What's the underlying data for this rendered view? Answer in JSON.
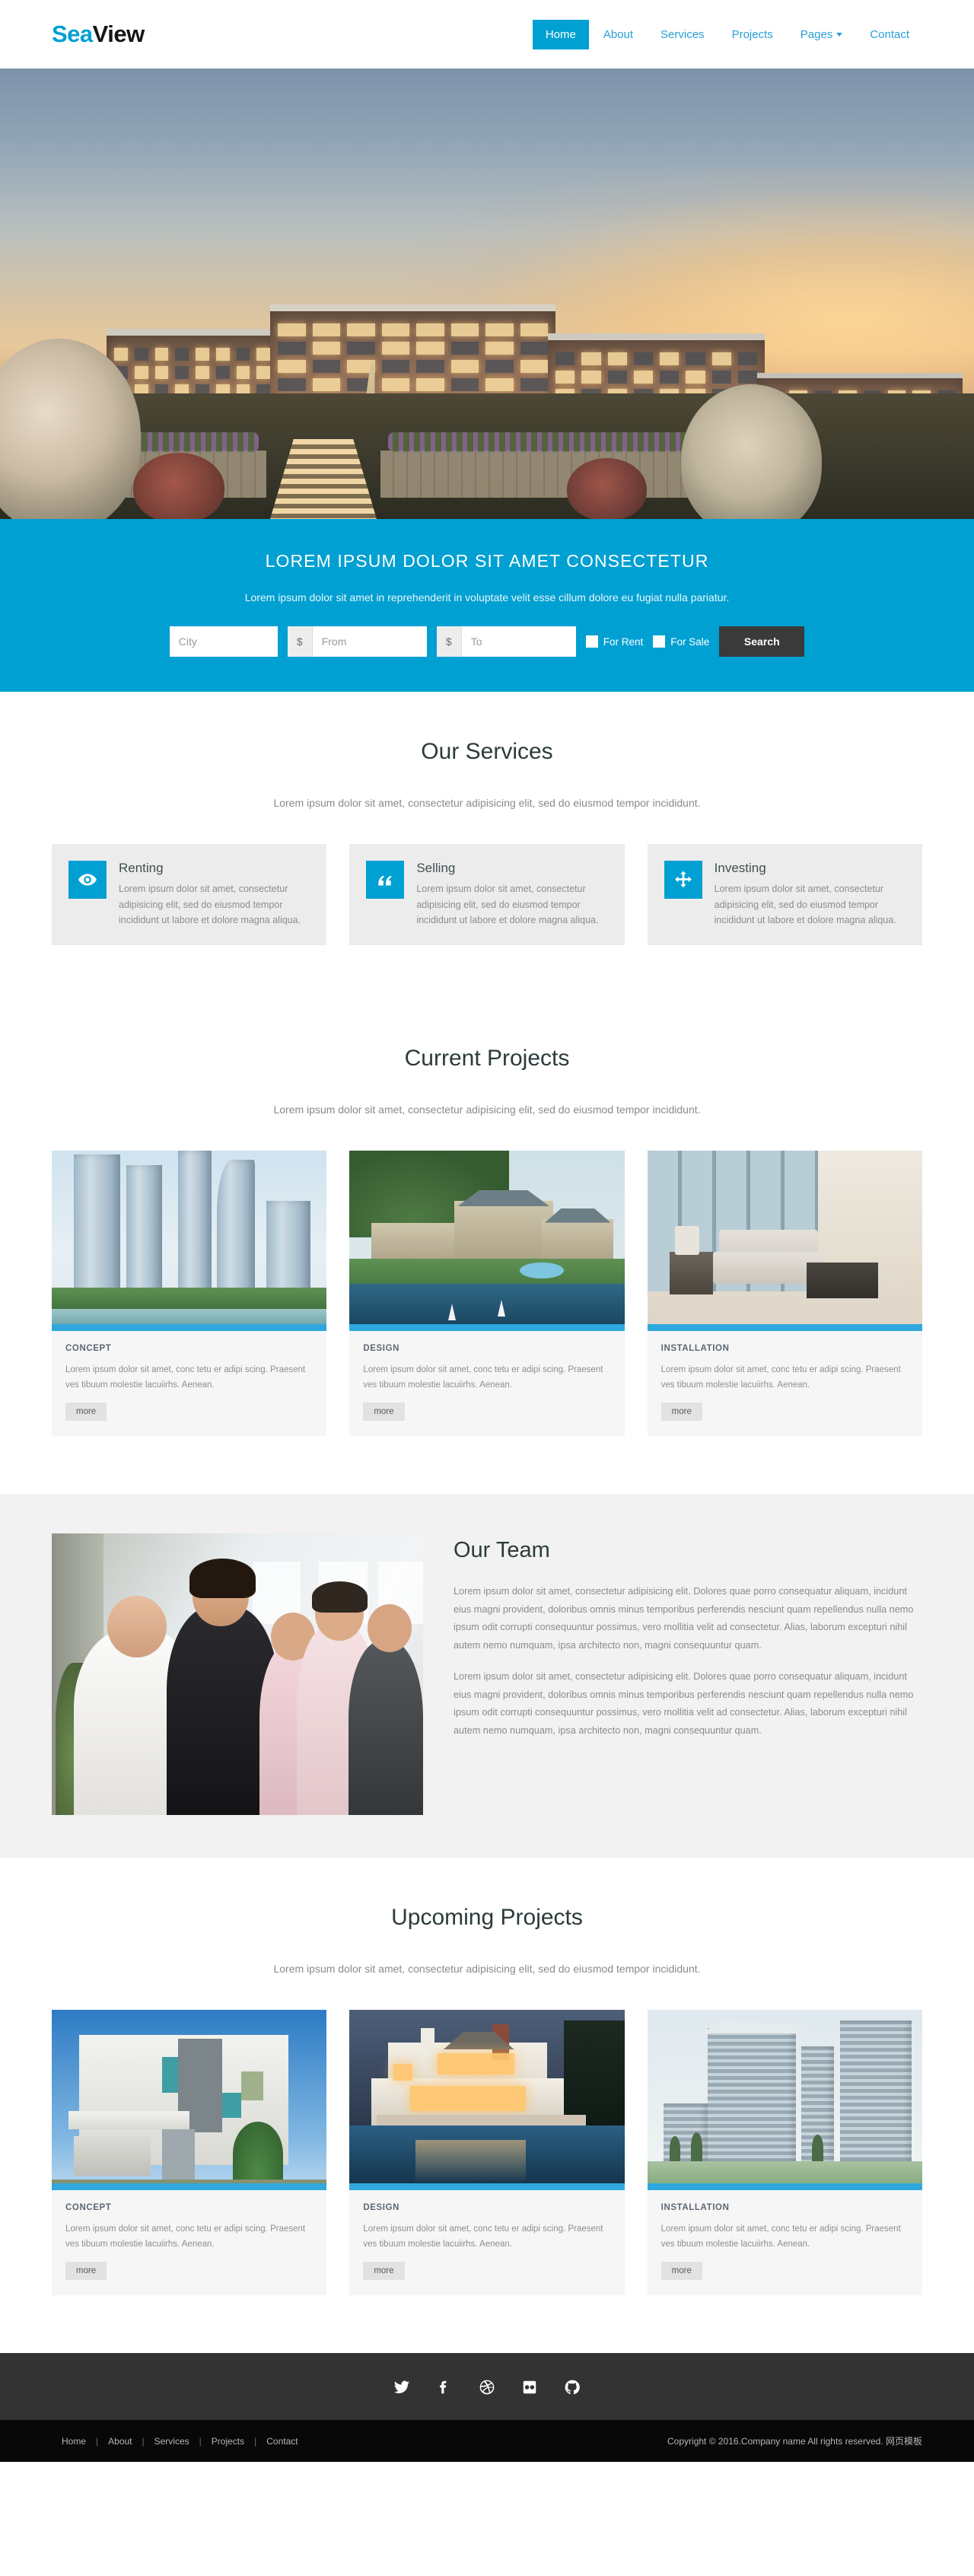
{
  "brand": {
    "part1": "Sea",
    "part2": "View"
  },
  "nav": {
    "items": [
      {
        "label": "Home",
        "active": true
      },
      {
        "label": "About",
        "active": false
      },
      {
        "label": "Services",
        "active": false
      },
      {
        "label": "Projects",
        "active": false,
        "caret": false
      },
      {
        "label": "Pages",
        "active": false,
        "caret": true
      },
      {
        "label": "Contact",
        "active": false
      }
    ]
  },
  "hero": {
    "image_description": "Large apartment complex at dusk with warm sunset sky, landscaped gardens, stairs and a sculpture"
  },
  "search_band": {
    "heading": "LOREM IPSUM DOLOR SIT AMET CONSECTETUR",
    "subheading": "Lorem ipsum dolor sit amet in reprehenderit in voluptate velit esse cillum dolore eu fugiat nulla pariatur.",
    "city_placeholder": "City",
    "from_placeholder": "From",
    "to_placeholder": "To",
    "currency_symbol": "$",
    "for_rent_label": "For Rent",
    "for_sale_label": "For Sale",
    "search_button": "Search"
  },
  "services": {
    "heading": "Our Services",
    "lead": "Lorem ipsum dolor sit amet, consectetur adipisicing elit, sed do eiusmod tempor incididunt.",
    "items": [
      {
        "icon": "eye-icon",
        "title": "Renting",
        "text": "Lorem ipsum dolor sit amet, consectetur adipisicing elit, sed do eiusmod tempor incididunt ut labore et dolore magna aliqua."
      },
      {
        "icon": "quote-icon",
        "title": "Selling",
        "text": "Lorem ipsum dolor sit amet, consectetur adipisicing elit, sed do eiusmod tempor incididunt ut labore et dolore magna aliqua."
      },
      {
        "icon": "move-arrows-icon",
        "title": "Investing",
        "text": "Lorem ipsum dolor sit amet, consectetur adipisicing elit, sed do eiusmod tempor incididunt ut labore et dolore magna aliqua."
      }
    ]
  },
  "current_projects": {
    "heading": "Current Projects",
    "lead": "Lorem ipsum dolor sit amet, consectetur adipisicing elit, sed do eiusmod tempor incididunt.",
    "items": [
      {
        "title": "CONCEPT",
        "text": "Lorem ipsum dolor sit amet, conc tetu er adipi scing. Praesent ves tibuum molestie lacuiirhs. Aenean.",
        "more": "more",
        "image_description": "Blue glass skyscrapers under construction beside a lake"
      },
      {
        "title": "DESIGN",
        "text": "Lorem ipsum dolor sit amet, conc tetu er adipi scing. Praesent ves tibuum molestie lacuiirhs. Aenean.",
        "more": "more",
        "image_description": "Hillside resort complex with waterfall, pool and sailboats on a lake"
      },
      {
        "title": "INSTALLATION",
        "text": "Lorem ipsum dolor sit amet, conc tetu er adipi scing. Praesent ves tibuum molestie lacuiirhs. Aenean.",
        "more": "more",
        "image_description": "Modern living room interior with white sofa and floor-to-ceiling city-view windows"
      }
    ]
  },
  "team": {
    "heading": "Our Team",
    "image_description": "Group of six smiling business professionals standing in a line",
    "paragraphs": [
      "Lorem ipsum dolor sit amet, consectetur adipisicing elit. Dolores quae porro consequatur aliquam, incidunt eius magni provident, doloribus omnis minus temporibus perferendis nesciunt quam repellendus nulla nemo ipsum odit corrupti consequuntur possimus, vero mollitia velit ad consectetur. Alias, laborum excepturi nihil autem nemo numquam, ipsa architecto non, magni consequuntur quam.",
      "Lorem ipsum dolor sit amet, consectetur adipisicing elit. Dolores quae porro consequatur aliquam, incidunt eius magni provident, doloribus omnis minus temporibus perferendis nesciunt quam repellendus nulla nemo ipsum odit corrupti consequuntur possimus, vero mollitia velit ad consectetur. Alias, laborum excepturi nihil autem nemo numquam, ipsa architecto non, magni consequuntur quam."
    ]
  },
  "upcoming_projects": {
    "heading": "Upcoming Projects",
    "lead": "Lorem ipsum dolor sit amet, consectetur adipisicing elit, sed do eiusmod tempor incididunt.",
    "items": [
      {
        "title": "CONCEPT",
        "text": "Lorem ipsum dolor sit amet, conc tetu er adipi scing. Praesent ves tibuum molestie lacuiirhs. Aenean.",
        "more": "more",
        "image_description": "Modern two-storey house with grey and white facade against blue sky"
      },
      {
        "title": "DESIGN",
        "text": "Lorem ipsum dolor sit amet, conc tetu er adipi scing. Praesent ves tibuum molestie lacuiirhs. Aenean.",
        "more": "more",
        "image_description": "Luxury villa lit up at dusk reflected in an infinity pool"
      },
      {
        "title": "INSTALLATION",
        "text": "Lorem ipsum dolor sit amet, conc tetu er adipi scing. Praesent ves tibuum molestie lacuiirhs. Aenean.",
        "more": "more",
        "image_description": "Glass and steel office tower complex with landscaped grounds"
      }
    ]
  },
  "footer": {
    "socials": [
      {
        "name": "twitter-icon"
      },
      {
        "name": "facebook-icon"
      },
      {
        "name": "dribbble-icon"
      },
      {
        "name": "flickr-icon"
      },
      {
        "name": "github-icon"
      }
    ],
    "links": [
      "Home",
      "About",
      "Services",
      "Projects",
      "Contact"
    ],
    "separator": "|",
    "copyright": "Copyright © 2016.Company name All rights reserved.  网页模板"
  },
  "colors": {
    "accent": "#00a0d2",
    "nav_link": "#2a9fd6",
    "dark_button": "#3a3a3a",
    "footer_top": "#333333",
    "footer_bottom": "#080808",
    "card_bg": "#f6f6f6",
    "service_bg": "#ececec",
    "thumb_bar": "#2fa8dd"
  }
}
